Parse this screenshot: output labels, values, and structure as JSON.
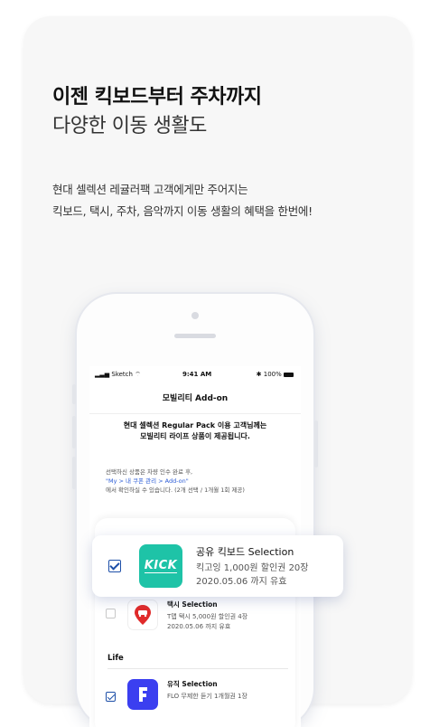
{
  "headline": {
    "line1": "이젠 킥보드부터 주차까지",
    "line2": "다양한 이동 생활도"
  },
  "description": {
    "line1": "현대 셀렉션 레귤러팩 고객에게만 주어지는",
    "line2": "킥보드, 택시, 주차, 음악까지 이동 생활의 혜택을 한번에!"
  },
  "phone": {
    "status": {
      "carrier": "Sketch",
      "time": "9:41 AM",
      "battery": "100%"
    },
    "nav_title": "모빌리티 Add-on",
    "notice": {
      "line1": "현대 셀렉션 Regular Pack 이용 고객님께는",
      "line2": "모빌리티 라이프 상품이 제공됩니다."
    },
    "info": {
      "line1": "선택하신 상품은 차량 인수 완료 후,",
      "line2": "\"My > 내 쿠폰 관리 > Add-on\"",
      "line3": "에서 확인하실 수 있습니다. (2개 선택 / 1개월 1회 제공)"
    },
    "items": [
      {
        "title": "택시 Selection",
        "sub1": "T맵 택시 5,000원 할인권 4장",
        "sub2": "2020.05.06 까지 유효",
        "checked": false,
        "icon": "location-pin-car-icon"
      },
      {
        "title": "유직 Selection",
        "sub1": "FLO 무제한 듣기 1개월권 1장",
        "checked": true,
        "icon": "flo-music-icon"
      }
    ],
    "section_label": "Life"
  },
  "popout": {
    "logo_text": "KICK",
    "title": "공유 킥보드 Selection",
    "sub1": "킥고잉 1,000원 할인권 20장",
    "sub2": "2020.05.06 까지 유효",
    "checked": true
  },
  "colors": {
    "accent_blue": "#1d4fa8",
    "kick_green": "#1ec3a7",
    "taxi_red": "#e02a2a",
    "flo_blue": "#3b3ff0"
  }
}
